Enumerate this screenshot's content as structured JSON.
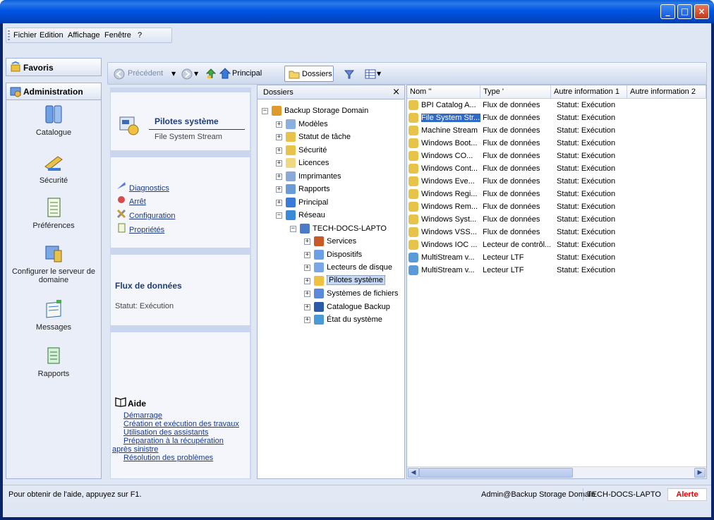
{
  "menu": {
    "items": [
      "Fichier",
      "Edition",
      "Affichage",
      "Fenêtre",
      "?"
    ]
  },
  "favoris": {
    "label": "Favoris"
  },
  "left_panel": {
    "title": "Administration",
    "items": [
      "Catalogue",
      "Sécurité",
      "Préférences",
      "Configurer le serveur de domaine",
      "Messages",
      "Rapports"
    ]
  },
  "toolbar": {
    "back": "Précédent",
    "home": "Principal",
    "folders": "Dossiers"
  },
  "task_pane": {
    "title": "Pilotes système",
    "subtitle": "File System Stream",
    "actions": [
      "Diagnostics",
      "Arrêt",
      "Configuration",
      "Propriétés"
    ],
    "stream_title": "Flux de données",
    "stream_status": "Statut: Exécution",
    "help_title": "Aide",
    "help_links": [
      "Démarrage",
      "Création et exécution des travaux",
      "Utilisation des assistants",
      "Préparation à la récupération après sinistre",
      "Résolution des problèmes"
    ]
  },
  "folders": {
    "title": "Dossiers",
    "close": "×",
    "tree": [
      {
        "label": "Backup Storage Domain",
        "exp": "−"
      },
      {
        "label": "Modèles",
        "exp": "+"
      },
      {
        "label": "Statut de tâche",
        "exp": "+"
      },
      {
        "label": "Sécurité",
        "exp": "+"
      },
      {
        "label": "Licences",
        "exp": "+"
      },
      {
        "label": "Imprimantes",
        "exp": "+"
      },
      {
        "label": "Rapports",
        "exp": "+"
      },
      {
        "label": "Principal",
        "exp": "+"
      },
      {
        "label": "Réseau",
        "exp": "−"
      },
      {
        "label": "TECH-DOCS-LAPTO",
        "exp": "−"
      },
      {
        "label": "Services",
        "exp": "+"
      },
      {
        "label": "Dispositifs",
        "exp": "+"
      },
      {
        "label": "Lecteurs de disque",
        "exp": "+"
      },
      {
        "label": "Pilotes système",
        "exp": "+"
      },
      {
        "label": "Systèmes de fichiers",
        "exp": "+"
      },
      {
        "label": "Catalogue Backup",
        "exp": "+"
      },
      {
        "label": "État du système",
        "exp": "+"
      }
    ]
  },
  "list": {
    "columns": [
      "Nom ''",
      "Type '",
      "Autre information 1",
      "Autre information 2"
    ],
    "rows": [
      {
        "name": "BPI Catalog A...",
        "type": "Flux de données",
        "info1": "Statut: Exécution"
      },
      {
        "name": "File System Str...",
        "type": "Flux de données",
        "info1": "Statut: Exécution"
      },
      {
        "name": "Machine Stream",
        "type": "Flux de données",
        "info1": "Statut: Exécution"
      },
      {
        "name": "Windows Boot...",
        "type": "Flux de données",
        "info1": "Statut: Exécution"
      },
      {
        "name": "Windows CO...",
        "type": "Flux de données",
        "info1": "Statut: Exécution"
      },
      {
        "name": "Windows Cont...",
        "type": "Flux de données",
        "info1": "Statut: Exécution"
      },
      {
        "name": "Windows Eve...",
        "type": "Flux de données",
        "info1": "Statut: Exécution"
      },
      {
        "name": "Windows Regi...",
        "type": "Flux de données",
        "info1": "Statut: Exécution"
      },
      {
        "name": "Windows Rem...",
        "type": "Flux de données",
        "info1": "Statut: Exécution"
      },
      {
        "name": "Windows Syst...",
        "type": "Flux de données",
        "info1": "Statut: Exécution"
      },
      {
        "name": "Windows VSS...",
        "type": "Flux de données",
        "info1": "Statut: Exécution"
      },
      {
        "name": "Windows IOC ...",
        "type": "Lecteur de contrôl...",
        "info1": "Statut: Exécution"
      },
      {
        "name": "MultiStream v...",
        "type": "Lecteur LTF",
        "info1": "Statut: Exécution"
      },
      {
        "name": "MultiStream v...",
        "type": "Lecteur LTF",
        "info1": "Statut: Exécution"
      }
    ]
  },
  "status": {
    "help": "Pour obtenir de l'aide, appuyez sur F1.",
    "user": "Admin@Backup Storage Domain",
    "server": "TECH-DOCS-LAPTO",
    "alert": "Alerte"
  },
  "colors": {
    "titlebar": "#0055e5",
    "selection": "#3169c6",
    "alert": "#e00000"
  }
}
